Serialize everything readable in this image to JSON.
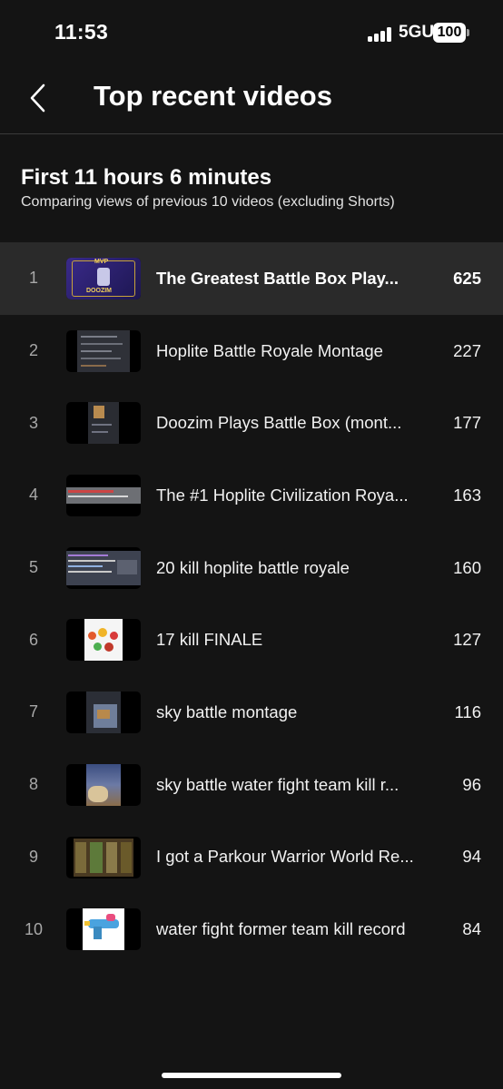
{
  "status_bar": {
    "time": "11:53",
    "network": "5GUC",
    "battery": "100",
    "signal_icon": "cellular-signal-icon"
  },
  "header": {
    "title": "Top recent videos",
    "back_icon": "chevron-left-icon"
  },
  "summary": {
    "title": "First 11 hours 6 minutes",
    "subtitle": "Comparing views of previous 10 videos (excluding Shorts)"
  },
  "videos": [
    {
      "rank": "1",
      "title": "The Greatest Battle Box Play...",
      "views": "625",
      "highlighted": true
    },
    {
      "rank": "2",
      "title": "Hoplite Battle Royale Montage",
      "views": "227"
    },
    {
      "rank": "3",
      "title": "Doozim Plays Battle Box (mont...",
      "views": "177"
    },
    {
      "rank": "4",
      "title": "The #1 Hoplite Civilization Roya...",
      "views": "163"
    },
    {
      "rank": "5",
      "title": "20 kill hoplite battle royale",
      "views": "160"
    },
    {
      "rank": "6",
      "title": "17 kill FINALE",
      "views": "127"
    },
    {
      "rank": "7",
      "title": "sky battle montage",
      "views": "116"
    },
    {
      "rank": "8",
      "title": "sky battle water fight team kill r...",
      "views": "96"
    },
    {
      "rank": "9",
      "title": "I got a Parkour Warrior World Re...",
      "views": "94"
    },
    {
      "rank": "10",
      "title": "water fight former team kill record",
      "views": "84"
    }
  ],
  "thumbnail_text": {
    "mvp": "MVP",
    "name": "DOOZIM"
  },
  "colors": {
    "background": "#141414",
    "highlight_row": "#2a2a2a",
    "divider": "#3a3a3a"
  }
}
